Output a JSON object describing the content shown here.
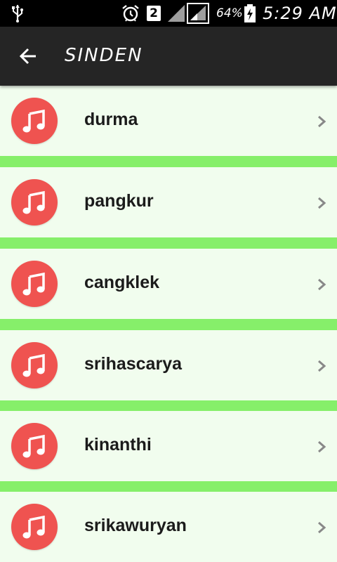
{
  "status_bar": {
    "sim_label": "2",
    "battery_percent": "64%",
    "time": "5:29 AM"
  },
  "app_bar": {
    "title": "SINDEN"
  },
  "items": [
    {
      "label": "durma"
    },
    {
      "label": "pangkur"
    },
    {
      "label": "cangklek"
    },
    {
      "label": "srihascarya"
    },
    {
      "label": "kinanthi"
    },
    {
      "label": "srikawuryan"
    }
  ],
  "colors": {
    "divider_green": "#86ef6a",
    "item_background": "#f1fdee",
    "icon_circle": "#ef5350",
    "app_bar": "#252525"
  }
}
